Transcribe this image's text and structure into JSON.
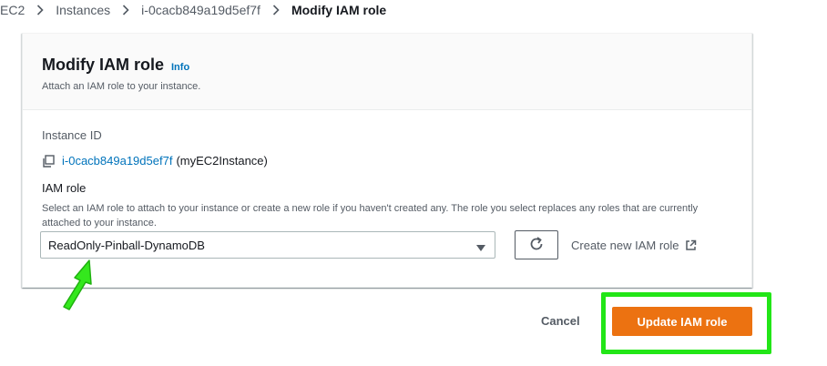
{
  "breadcrumb": {
    "items": [
      "EC2",
      "Instances",
      "i-0cacb849a19d5ef7f"
    ],
    "current": "Modify IAM role"
  },
  "card": {
    "title": "Modify IAM role",
    "info": "Info",
    "description": "Attach an IAM role to your instance."
  },
  "instance": {
    "label": "Instance ID",
    "id": "i-0cacb849a19d5ef7f",
    "name": "(myEC2Instance)"
  },
  "iam_role": {
    "label": "IAM role",
    "description": "Select an IAM role to attach to your instance or create a new role if you haven't created any. The role you select replaces any roles that are currently attached to your instance.",
    "selected": "ReadOnly-Pinball-DynamoDB",
    "create_link": "Create new IAM role"
  },
  "actions": {
    "cancel": "Cancel",
    "update": "Update IAM role"
  },
  "colors": {
    "primary_button": "#ec7211",
    "link": "#0073bb",
    "annotation": "#22e617"
  },
  "icons": [
    "chevron-right-icon",
    "copy-icon",
    "caret-down-icon",
    "refresh-icon",
    "external-link-icon",
    "arrow-annotation-icon"
  ]
}
